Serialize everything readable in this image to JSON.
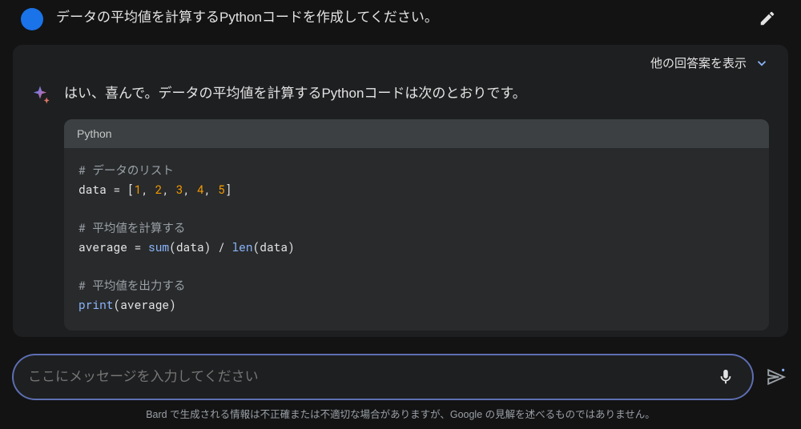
{
  "prompt": {
    "text": "データの平均値を計算するPythonコードを作成してください。"
  },
  "response": {
    "show_drafts_label": "他の回答案を表示",
    "intro_text": "はい、喜んで。データの平均値を計算するPythonコードは次のとおりです。"
  },
  "code": {
    "language_label": "Python",
    "comment1": "# データのリスト",
    "line2_lhs": "data",
    "line2_eq": " = ",
    "line2_open": "[",
    "line2_n1": "1",
    "line2_c": ", ",
    "line2_n2": "2",
    "line2_n3": "3",
    "line2_n4": "4",
    "line2_n5": "5",
    "line2_close": "]",
    "comment2": "# 平均値を計算する",
    "line4_lhs": "average",
    "line4_eq": " = ",
    "line4_fn1": "sum",
    "line4_p": "(data) / ",
    "line4_fn2": "len",
    "line4_p2": "(data)",
    "comment3": "# 平均値を出力する",
    "line6_fn": "print",
    "line6_p": "(average)"
  },
  "input": {
    "placeholder": "ここにメッセージを入力してください"
  },
  "footer": {
    "disclaimer": "Bard で生成される情報は不正確または不適切な場合がありますが、Google の見解を述べるものではありません。"
  }
}
